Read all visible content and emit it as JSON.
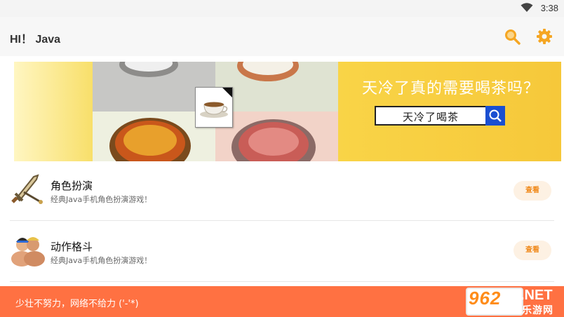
{
  "status_bar": {
    "time": "3:38",
    "wifi_icon": "wifi-icon"
  },
  "app_bar": {
    "title": "HI！ Java",
    "search_icon": "search-icon",
    "settings_icon": "gear-icon",
    "accent": "#f5a623"
  },
  "banner": {
    "headline": "天冷了真的需要喝茶吗？",
    "search_text": "天冷了喝茶",
    "search_icon": "search-icon"
  },
  "items": [
    {
      "name": "角色扮演",
      "desc": "经典Java手机角色扮演游戏！",
      "button": "查看",
      "icon": "sword-icon"
    },
    {
      "name": "动作格斗",
      "desc": "经典Java手机角色扮演游戏！",
      "button": "查看",
      "icon": "fighters-icon"
    }
  ],
  "toast": {
    "message": "少壮不努力，网络不给力 ('-'*)",
    "color": "#ff7142"
  },
  "watermark": {
    "number": "962",
    "net": ".NET",
    "site": "乐游网"
  }
}
